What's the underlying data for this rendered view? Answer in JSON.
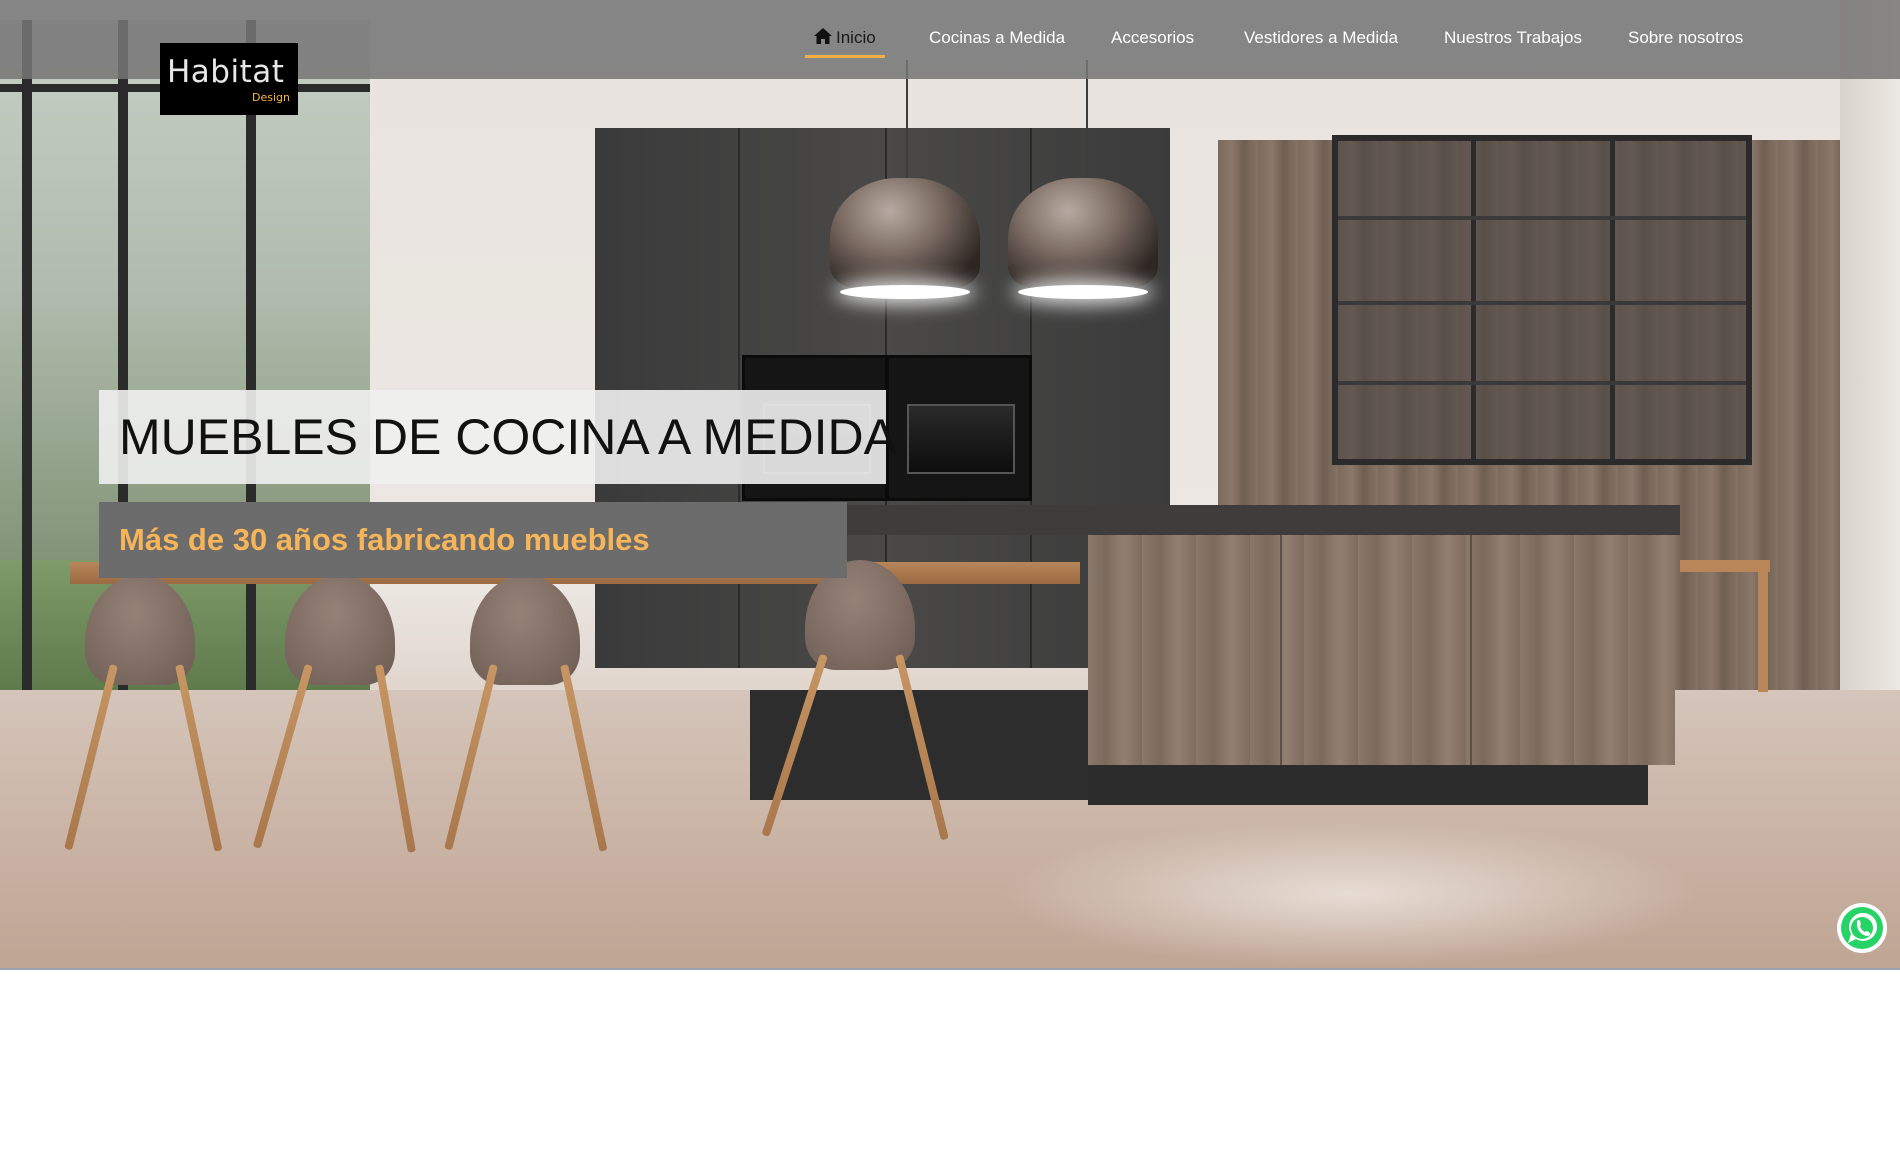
{
  "brand": {
    "logo_word": "Habitat",
    "logo_sub": "Design",
    "accent": "#f7b642"
  },
  "nav": {
    "items": [
      {
        "label": "Inicio",
        "icon": "home-icon",
        "active": true
      },
      {
        "label": "Cocinas a Medida"
      },
      {
        "label": "Accesorios"
      },
      {
        "label": "Vestidores a Medida"
      },
      {
        "label": "Nuestros Trabajos"
      },
      {
        "label": "Sobre nosotros"
      }
    ],
    "active_underline_color": "#f2ad44"
  },
  "hero": {
    "title": "MUEBLES DE COCINA A MEDIDA",
    "subtitle": "Más de 30 años fabricando muebles",
    "subtitle_color": "#f7b55a",
    "background": "kitchen-photo"
  },
  "floating": {
    "whatsapp_icon": "whatsapp-icon",
    "whatsapp_color": "#25d366"
  }
}
